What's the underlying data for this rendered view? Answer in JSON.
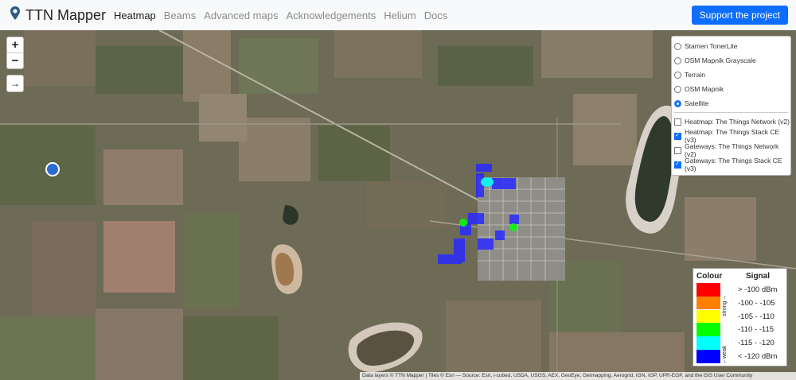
{
  "navbar": {
    "brand": "TTN Mapper",
    "links": [
      "Heatmap",
      "Beams",
      "Advanced maps",
      "Acknowledgements",
      "Helium",
      "Docs"
    ],
    "active_link": "Heatmap",
    "cta_label": "Support the project",
    "brand_icon": "map-pin-icon"
  },
  "map_controls": {
    "zoom_in": "+",
    "zoom_out": "−",
    "arrow": "→"
  },
  "layers": {
    "base_layers": [
      {
        "label": "Stamen TonerLite",
        "selected": false
      },
      {
        "label": "OSM Mapnik Grayscale",
        "selected": false
      },
      {
        "label": "Terrain",
        "selected": false
      },
      {
        "label": "OSM Mapnik",
        "selected": false
      },
      {
        "label": "Satellite",
        "selected": true
      }
    ],
    "overlays": [
      {
        "label": "Heatmap: The Things Network (v2)",
        "checked": false
      },
      {
        "label": "Heatmap: The Things Stack CE (v3)",
        "checked": true
      },
      {
        "label": "Gateways: The Things Network (v2)",
        "checked": false
      },
      {
        "label": "Gateways: The Things Stack CE (v3)",
        "checked": true
      }
    ]
  },
  "legend": {
    "colour_header": "Colour",
    "signal_header": "Signal",
    "strong_label": "strong→",
    "weak_label": "←weak",
    "rows": [
      {
        "color": "#ff0000",
        "label": "> -100 dBm"
      },
      {
        "color": "#ff7f00",
        "label": "-100 - -105"
      },
      {
        "color": "#ffff00",
        "label": "-105 - -110"
      },
      {
        "color": "#00ff00",
        "label": "-110 - -115"
      },
      {
        "color": "#00ffff",
        "label": "-115 - -120"
      },
      {
        "color": "#0000ff",
        "label": "< -120 dBm"
      }
    ]
  },
  "attribution": "Data layers © TTN Mapper | Tiles © Esri — Source: Esri, i-cubed, USDA, USGS, AEX, GeoEye, Getmapping, Aerogrid, IGN, IGP, UPR-EGP, and the GIS User Community"
}
